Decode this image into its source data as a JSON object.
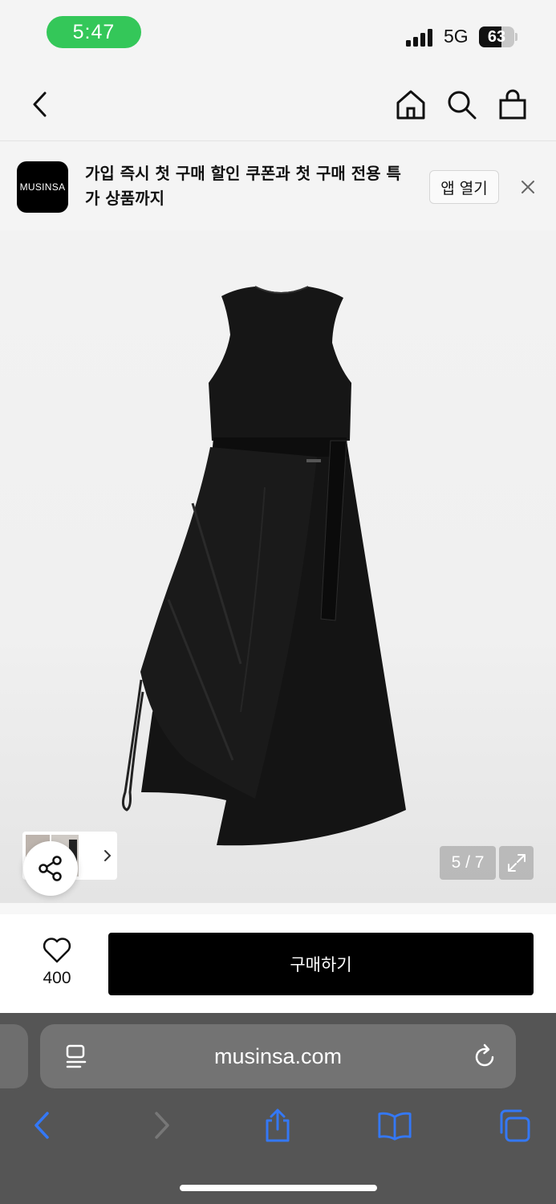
{
  "status": {
    "time": "5:47",
    "network": "5G",
    "battery": "63",
    "battery_level": 0.63
  },
  "nav": {
    "icons": [
      "back-icon",
      "home-icon",
      "search-icon",
      "cart-icon"
    ]
  },
  "banner": {
    "logo": "MUSINSA",
    "text": "가입 즉시 첫 구매 할인 쿠폰과 첫 구매 전용 특가 상품까지",
    "open_app": "앱 열기"
  },
  "product": {
    "counter": "5 / 7",
    "current_image": 5,
    "total_images": 7
  },
  "actions": {
    "like_count": "400",
    "buy_label": "구매하기"
  },
  "browser": {
    "url": "musinsa.com",
    "colors": {
      "accent": "#3478f6"
    }
  }
}
